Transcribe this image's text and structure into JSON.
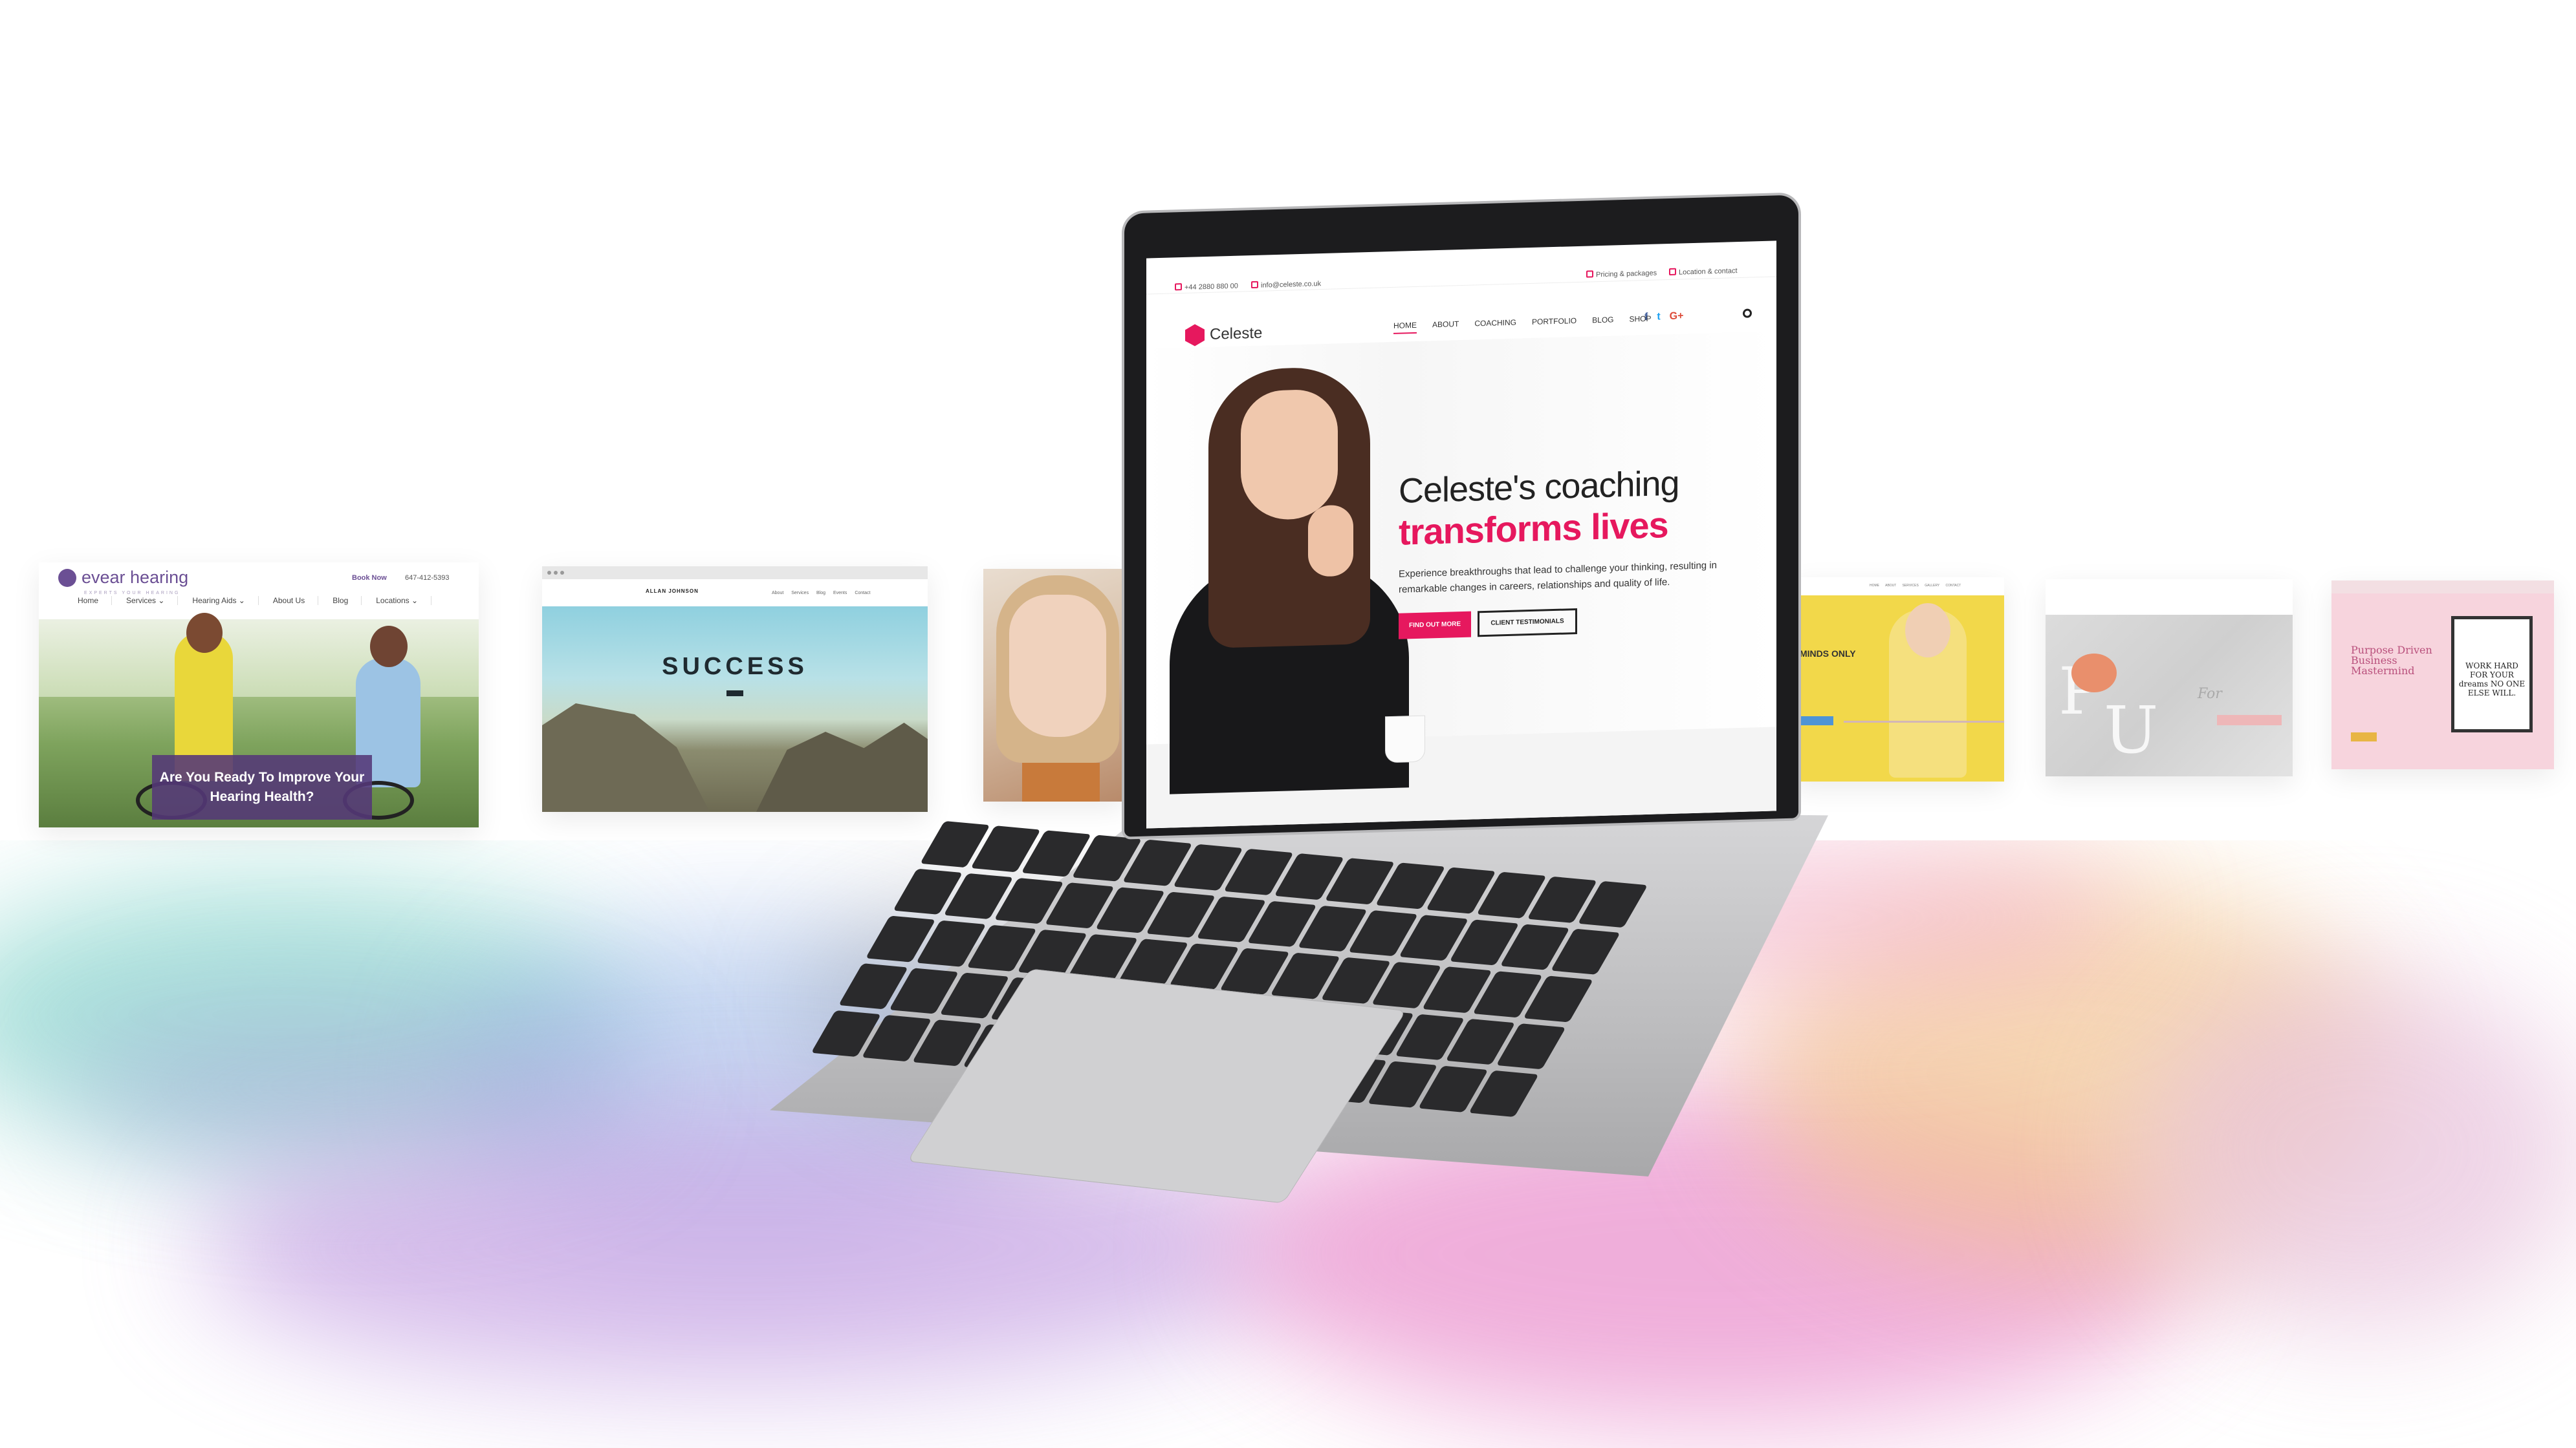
{
  "panels": {
    "evear": {
      "brand": "evear hearing",
      "tagline": "EXPERTS YOUR HEARING",
      "book_label": "Book Now",
      "phone": "647-412-5393",
      "nav": [
        "Home",
        "Services ⌄",
        "Hearing Aids ⌄",
        "About Us",
        "Blog",
        "Locations ⌄"
      ],
      "cta": "Are You Ready To Improve Your Hearing Health?"
    },
    "success": {
      "brand": "ALLAN JOHNSON",
      "nav": "About Services Blog Events Contact",
      "title": "SUCCESS"
    },
    "yellow": {
      "nav": "HOME ABOUT SERVICES GALLERY CONTACT",
      "text": "MINDS ONLY"
    },
    "flowers": {
      "script": "For"
    },
    "pink": {
      "title": "Purpose Driven Business Mastermind",
      "quote": "WORK HARD FOR YOUR dreams NO ONE ELSE WILL."
    }
  },
  "laptop": {
    "topbar": {
      "phone": "+44 2880 880 00",
      "email": "info@celeste.co.uk",
      "pricing": "Pricing & packages",
      "location": "Location & contact"
    },
    "logo_text": "Celeste",
    "nav": [
      "HOME",
      "ABOUT",
      "COACHING",
      "PORTFOLIO",
      "BLOG",
      "SHOP"
    ],
    "social": {
      "facebook": "f",
      "twitter": "t",
      "google": "G+"
    },
    "hero": {
      "line1": "Celeste's coaching",
      "line2": "transforms lives",
      "text": "Experience breakthroughs that lead to challenge your thinking, resulting in remarkable changes in careers, relationships and quality of life.",
      "btn_primary": "FIND OUT MORE",
      "btn_secondary": "CLIENT TESTIMONIALS"
    },
    "accent": "#e6185e"
  }
}
